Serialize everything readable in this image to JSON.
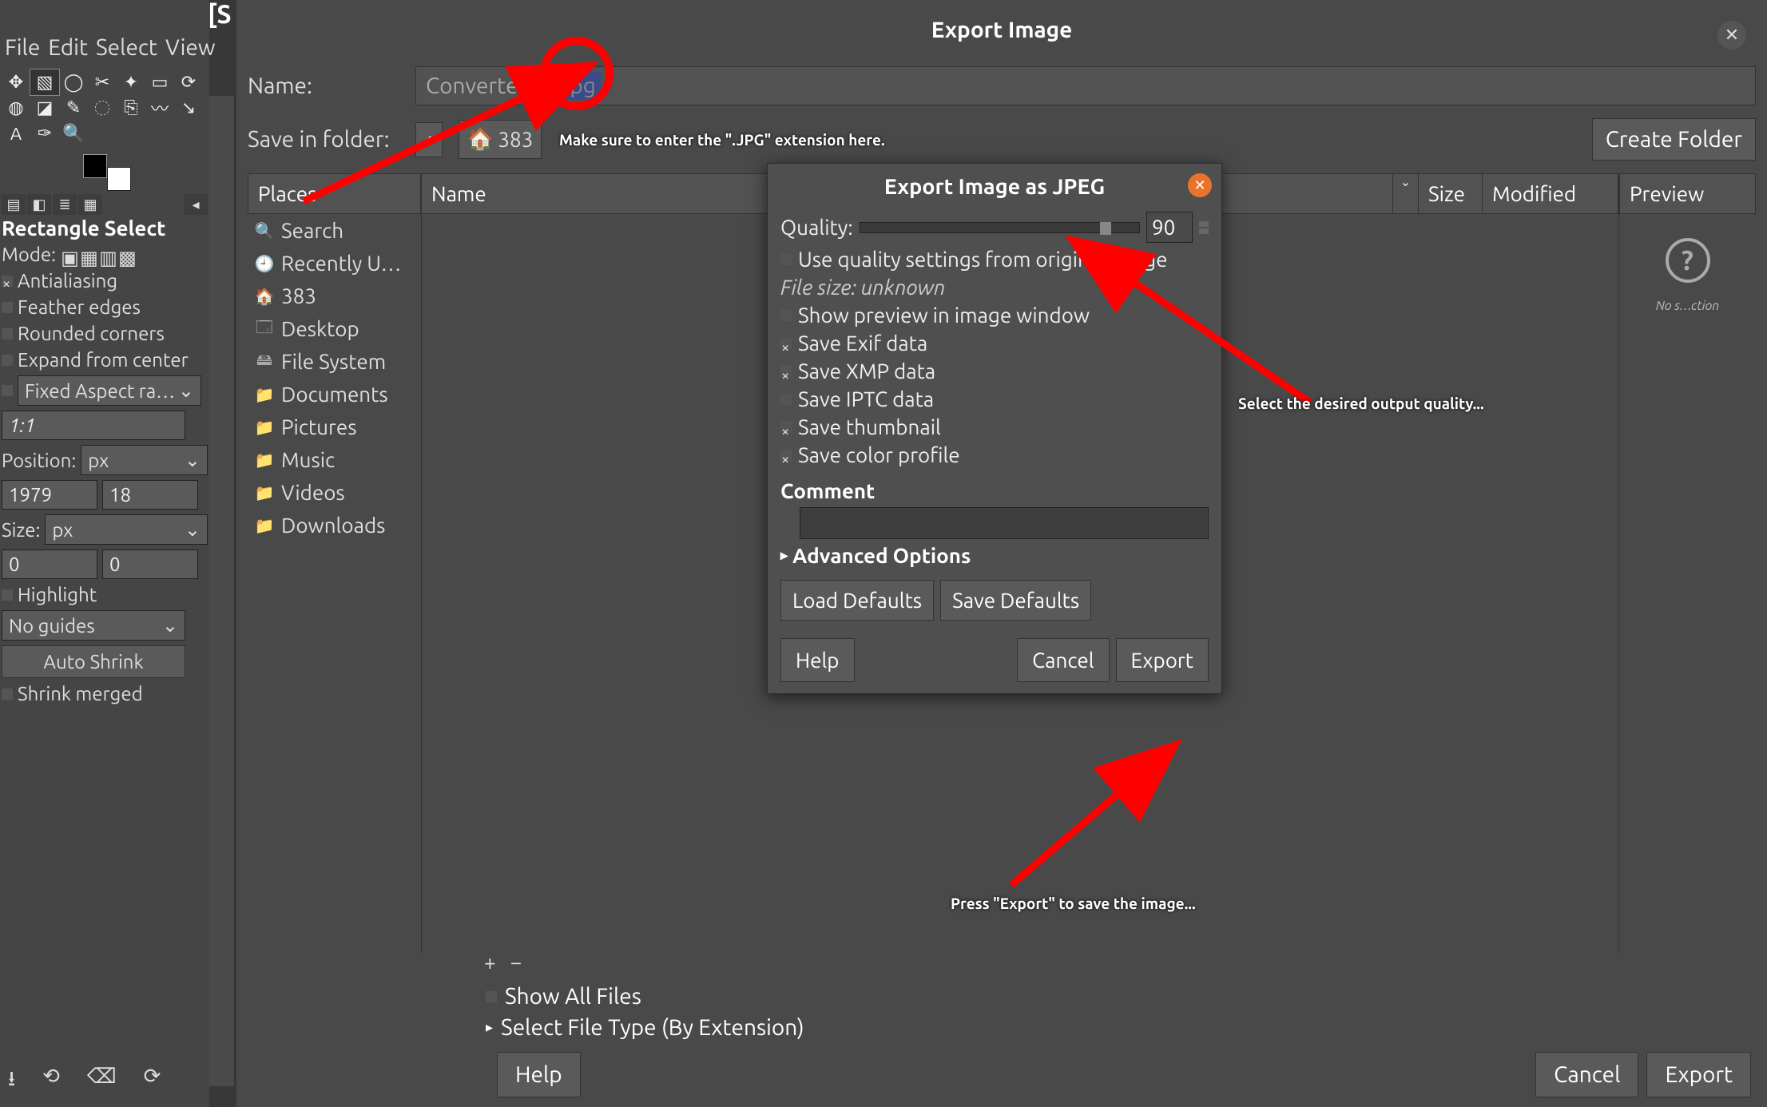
{
  "gimp": {
    "title_fragment": "[S",
    "menu": {
      "file": "File",
      "edit": "Edit",
      "select": "Select",
      "view": "View"
    },
    "tool_option_title": "Rectangle Select",
    "mode_label": "Mode:",
    "antialiasing": "Antialiasing",
    "feather": "Feather edges",
    "rounded": "Rounded corners",
    "expand": "Expand from center",
    "fixed_label": "Fixed Aspect ra…",
    "ratio": "1:1",
    "position_label": "Position:",
    "pos_unit": "px",
    "pos_x": "1979",
    "pos_y": "18",
    "size_label": "Size:",
    "size_unit": "px",
    "size_w": "0",
    "size_h": "0",
    "highlight": "Highlight",
    "guides": "No guides",
    "auto_shrink": "Auto Shrink",
    "shrink_merged": "Shrink merged"
  },
  "export": {
    "title": "Export Image",
    "name_label": "Name:",
    "name_prefix": "ConverterAp",
    "name_ext": ".jpg",
    "save_in_label": "Save in folder:",
    "path_folder": "383",
    "create_folder": "Create Folder",
    "columns": {
      "places": "Places",
      "name": "Name",
      "size": "Size",
      "modified": "Modified",
      "preview": "Preview"
    },
    "places": [
      {
        "icon": "search",
        "label": "Search"
      },
      {
        "icon": "recent",
        "label": "Recently U…"
      },
      {
        "icon": "home",
        "label": "383"
      },
      {
        "icon": "desktop",
        "label": "Desktop"
      },
      {
        "icon": "disk",
        "label": "File System"
      },
      {
        "icon": "folder",
        "label": "Documents"
      },
      {
        "icon": "folder",
        "label": "Pictures"
      },
      {
        "icon": "folder",
        "label": "Music"
      },
      {
        "icon": "folder",
        "label": "Videos"
      },
      {
        "icon": "folder",
        "label": "Downloads"
      }
    ],
    "preview_msg": "No s…ction",
    "show_all": "Show All Files",
    "select_type": "Select File Type (By Extension)",
    "help": "Help",
    "cancel": "Cancel",
    "export_btn": "Export"
  },
  "jpeg": {
    "title": "Export Image as JPEG",
    "quality_label": "Quality:",
    "quality": 90,
    "use_orig": "Use quality settings from original image",
    "file_size": "File size: unknown",
    "show_preview": "Show preview in image window",
    "save_exif": "Save Exif data",
    "save_xmp": "Save XMP data",
    "save_iptc": "Save IPTC data",
    "save_thumb": "Save thumbnail",
    "save_color": "Save color profile",
    "comment_label": "Comment",
    "advanced": "Advanced Options",
    "load_defaults": "Load Defaults",
    "save_defaults": "Save Defaults",
    "help": "Help",
    "cancel": "Cancel",
    "export": "Export"
  },
  "annotations": {
    "extension_note": "Make sure to enter the \".JPG\" extension here.",
    "quality_note": "Select the desired output quality...",
    "export_note": "Press \"Export\" to save the image..."
  }
}
